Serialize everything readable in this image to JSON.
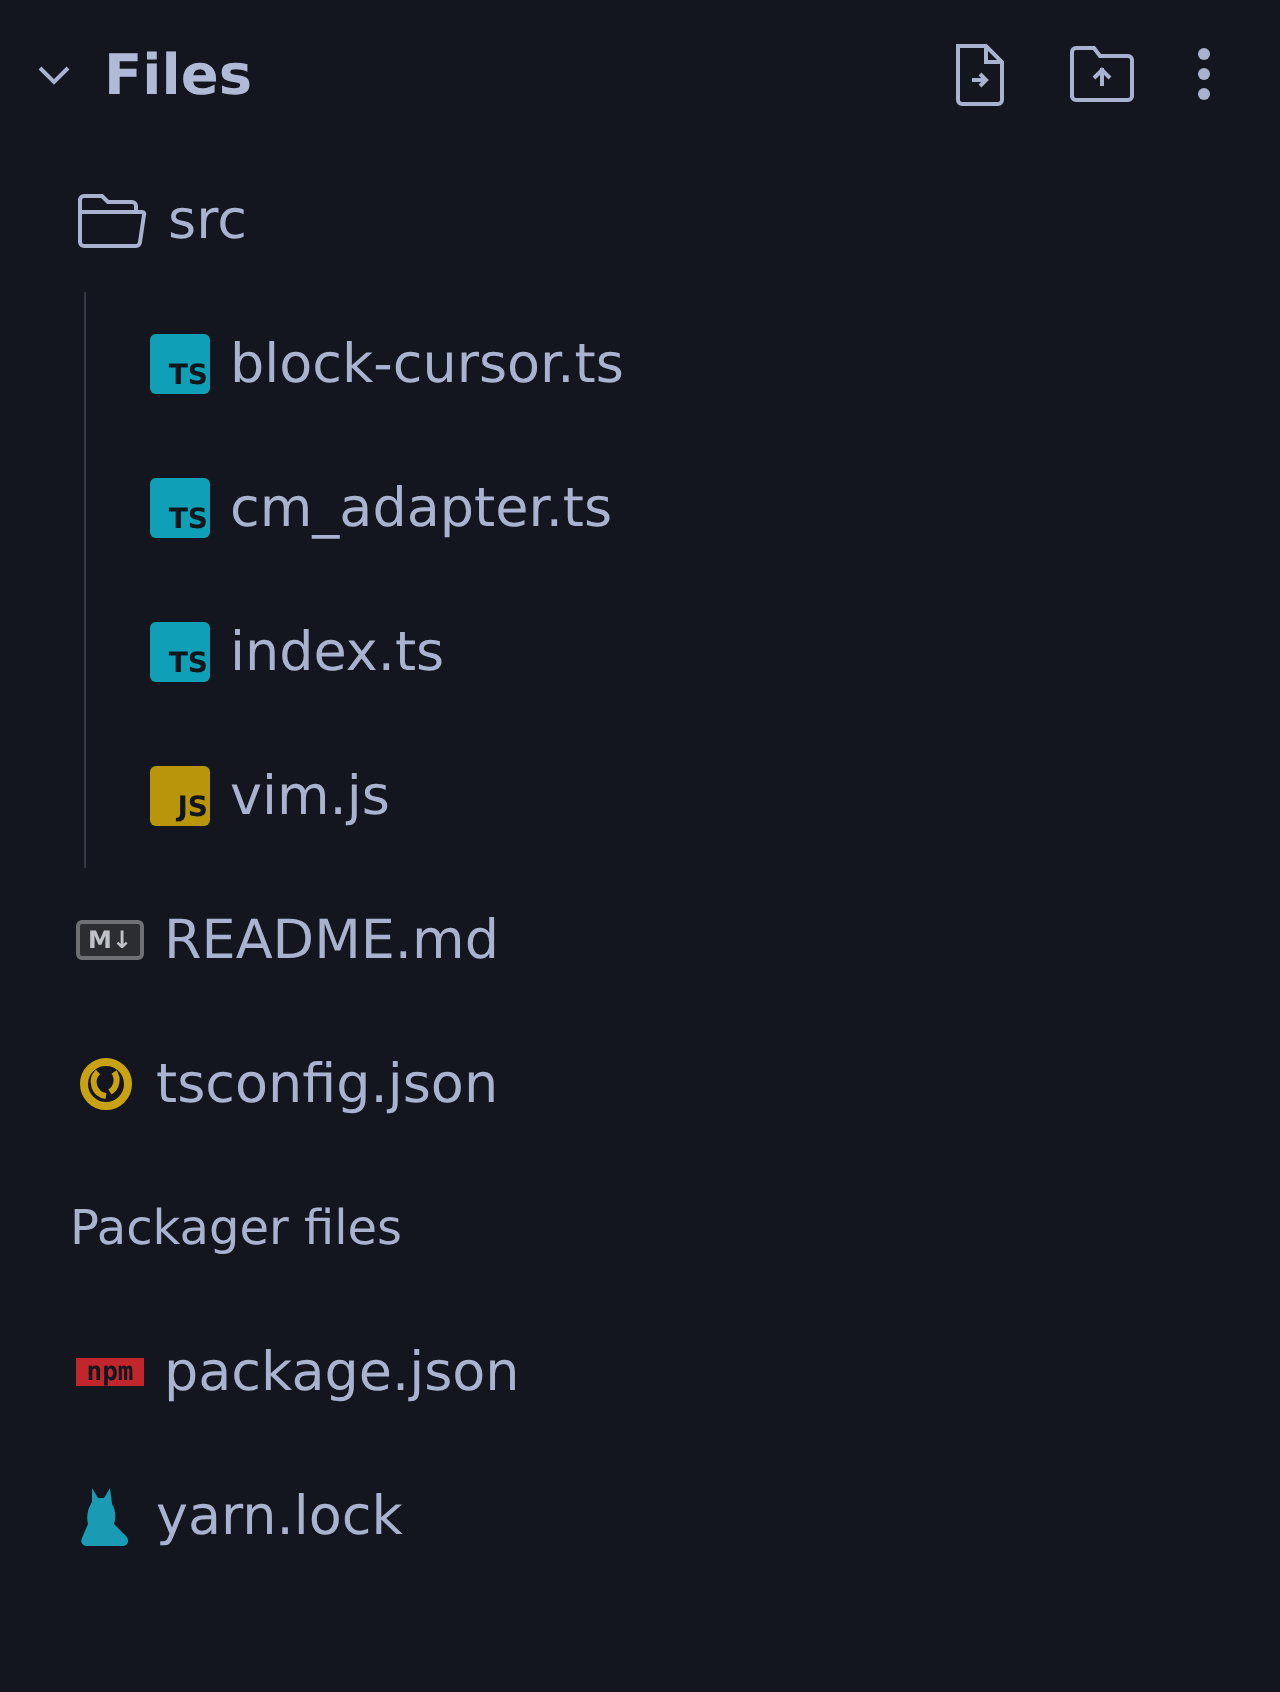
{
  "header": {
    "title": "Files",
    "expanded": true
  },
  "files": [
    {
      "name": "src",
      "kind": "folder",
      "expanded": true,
      "children": [
        {
          "name": "block-cursor.ts",
          "kind": "ts",
          "badge": "TS"
        },
        {
          "name": "cm_adapter.ts",
          "kind": "ts",
          "badge": "TS"
        },
        {
          "name": "index.ts",
          "kind": "ts",
          "badge": "TS"
        },
        {
          "name": "vim.js",
          "kind": "js",
          "badge": "JS"
        }
      ]
    },
    {
      "name": "README.md",
      "kind": "markdown",
      "badge": "M↓"
    },
    {
      "name": "tsconfig.json",
      "kind": "config"
    }
  ],
  "packager": {
    "title": "Packager files",
    "files": [
      {
        "name": "package.json",
        "kind": "npm",
        "badge": "npm"
      },
      {
        "name": "yarn.lock",
        "kind": "yarn"
      }
    ]
  }
}
